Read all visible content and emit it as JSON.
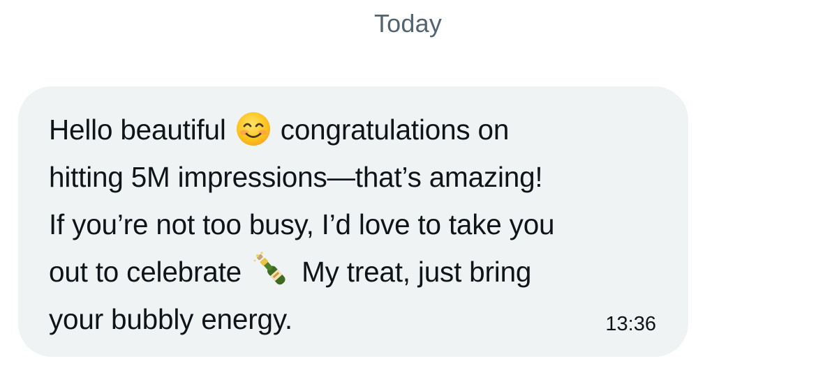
{
  "date_separator": "Today",
  "message": {
    "lines": [
      {
        "before": "Hello beautiful",
        "emoji": "smiling-face-icon",
        "after": "congratulations on"
      },
      {
        "text": "hitting 5M impressions—that’s amazing!"
      },
      {
        "text": "If you’re not too busy, I’d love to take you"
      },
      {
        "before": "out to celebrate",
        "emoji": "champagne-bottle-icon",
        "after": "My treat, just bring"
      },
      {
        "text": "your bubbly energy."
      }
    ],
    "time": "13:36"
  },
  "colors": {
    "bubble_background": "#eff3f4",
    "text": "#0f1419",
    "muted": "#536471"
  }
}
